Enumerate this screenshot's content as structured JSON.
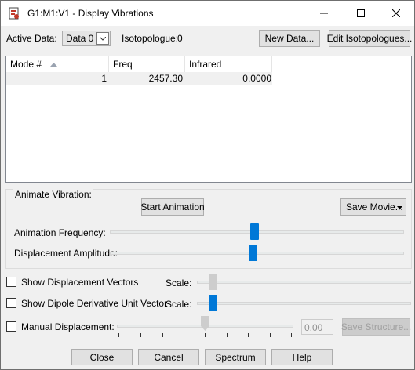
{
  "window": {
    "title": "G1:M1:V1 - Display Vibrations",
    "minimize": "—",
    "maximize": "☐",
    "close": "✕"
  },
  "toolbar": {
    "active_data_label": "Active Data:",
    "active_data_value": "Data 0",
    "isotopologue_label": "Isotopologue:",
    "isotopologue_value": "0",
    "new_data": "New Data...",
    "edit_isotopologues": "Edit Isotopologues..."
  },
  "table": {
    "columns": [
      "Mode #",
      "Freq",
      "Infrared"
    ],
    "rows": [
      [
        "1",
        "2457.30",
        "0.0000"
      ]
    ]
  },
  "animate": {
    "group_label": "Animate Vibration:",
    "start": "Start Animation",
    "save_movie": "Save Movie...",
    "frequency_label": "Animation Frequency:",
    "amplitude_label": "Displacement Amplitude:"
  },
  "options": {
    "show_displacement_vectors": "Show Displacement Vectors",
    "show_dipole": "Show Dipole Derivative Unit Vector",
    "scale_label": "Scale:",
    "manual_displacement": "Manual Displacement:",
    "manual_value": "0.00",
    "save_structure": "Save Structure..."
  },
  "footer": {
    "close": "Close",
    "cancel": "Cancel",
    "spectrum": "Spectrum",
    "help": "Help"
  },
  "colors": {
    "accent": "#0078d7",
    "dialog_bg": "#f0f0f0",
    "button_bg": "#e1e1e1"
  }
}
